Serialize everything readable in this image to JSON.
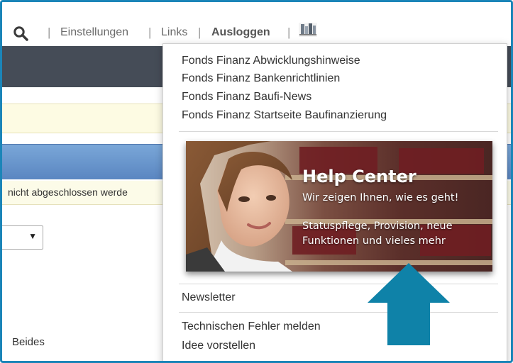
{
  "topbar": {
    "settings": "Einstellungen",
    "links": "Links",
    "logout": "Ausloggen",
    "separator": "|"
  },
  "page": {
    "warning_text": "nicht abgeschlossen werde",
    "select_value": "",
    "option_beides": "Beides"
  },
  "dropdown": {
    "links": [
      "Fonds Finanz Abwicklungshinweise",
      "Fonds Finanz Bankenrichtlinien",
      "Fonds Finanz Baufi-News",
      "Fonds Finanz Startseite Baufinanzierung"
    ],
    "banner": {
      "title": "Help Center",
      "subtitle": "Wir zeigen Ihnen, wie es geht!",
      "line1": "Statuspflege, Provision, neue",
      "line2": "Funktionen und vieles mehr"
    },
    "newsletter": "Newsletter",
    "report_error": "Technischen Fehler melden",
    "suggest_idea": "Idee vorstellen"
  },
  "colors": {
    "frame": "#1b85b8",
    "arrow": "#0f82a8",
    "navband": "#454c57"
  },
  "icons": {
    "search": "search-icon",
    "user": "user-icon",
    "dropdown": "chevron-down-icon"
  }
}
